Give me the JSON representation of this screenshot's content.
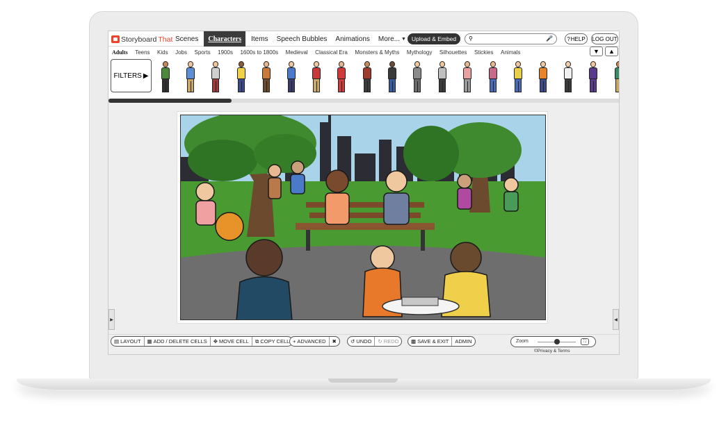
{
  "logo": {
    "part1": "Storyboard",
    "part2": "That"
  },
  "nav": {
    "tabs": [
      "Scenes",
      "Characters",
      "Items",
      "Speech Bubbles",
      "Animations",
      "More..."
    ],
    "active_index": 1,
    "upload_label": "Upload & Embed",
    "search_placeholder": "",
    "help_label": "HELP",
    "logout_label": "LOG OUT"
  },
  "categories": {
    "items": [
      "Adults",
      "Teens",
      "Kids",
      "Jobs",
      "Sports",
      "1900s",
      "1600s to 1800s",
      "Medieval",
      "Classical Era",
      "Monsters & Myths",
      "Mythology",
      "Silhouettes",
      "Stickies",
      "Animals"
    ],
    "active_index": 0
  },
  "filters": {
    "label": "FILTERS"
  },
  "characters": [
    {
      "skin": "#c98a5a",
      "top": "#4a8a3a",
      "bottom": "#2f2f2f"
    },
    {
      "skin": "#f2c9a0",
      "top": "#5b8fd6",
      "bottom": "#c9a96a"
    },
    {
      "skin": "#f0c8a0",
      "top": "#d0d0d0",
      "bottom": "#9a3a3a"
    },
    {
      "skin": "#8a5a3a",
      "top": "#f0d24a",
      "bottom": "#3a4a8a"
    },
    {
      "skin": "#e8b890",
      "top": "#c87a3a",
      "bottom": "#6a4a2a"
    },
    {
      "skin": "#f0c8a0",
      "top": "#4a7ac8",
      "bottom": "#3a3a6a"
    },
    {
      "skin": "#f0c8a0",
      "top": "#c83a3a",
      "bottom": "#c9a96a"
    },
    {
      "skin": "#e8b890",
      "top": "#d03a3a",
      "bottom": "#d03a3a"
    },
    {
      "skin": "#c98a5a",
      "top": "#a03a2a",
      "bottom": "#3a3a3a"
    },
    {
      "skin": "#6a4a3a",
      "top": "#3a3a3a",
      "bottom": "#3a5a9a"
    },
    {
      "skin": "#f0c8a0",
      "top": "#8a8a8a",
      "bottom": "#6a6a6a"
    },
    {
      "skin": "#f0c8a0",
      "top": "#c0c0c0",
      "bottom": "#3a3a3a"
    },
    {
      "skin": "#e8b890",
      "top": "#e8a0a0",
      "bottom": "#9a9a9a"
    },
    {
      "skin": "#e8b890",
      "top": "#c86a8a",
      "bottom": "#4a6ab8"
    },
    {
      "skin": "#f0c8a0",
      "top": "#e8d04a",
      "bottom": "#4a6ab8"
    },
    {
      "skin": "#f0c8a0",
      "top": "#e8842a",
      "bottom": "#3a4a8a"
    },
    {
      "skin": "#f0d0b0",
      "top": "#f0f0f0",
      "bottom": "#3a3a3a"
    },
    {
      "skin": "#f0c8a0",
      "top": "#5a3a8a",
      "bottom": "#5a3a8a"
    },
    {
      "skin": "#c98a5a",
      "top": "#3a8a6a",
      "bottom": "#c9a96a"
    }
  ],
  "toolbar": {
    "layout": "LAYOUT",
    "add_delete": "ADD / DELETE CELLS",
    "move": "MOVE CELL",
    "copy": "COPY CELL",
    "advanced": "ADVANCED",
    "undo": "UNDO",
    "redo": "REDO",
    "save_exit": "SAVE & EXIT",
    "admin": "ADMIN",
    "zoom_label": "Zoom",
    "zoom_level": 0.5,
    "privacy": "©Privacy & Terms"
  },
  "colors": {
    "brand": "#e8452c",
    "sky": "#a9d3e8",
    "grass": "#4a9a32",
    "path": "#6e6e6e"
  }
}
